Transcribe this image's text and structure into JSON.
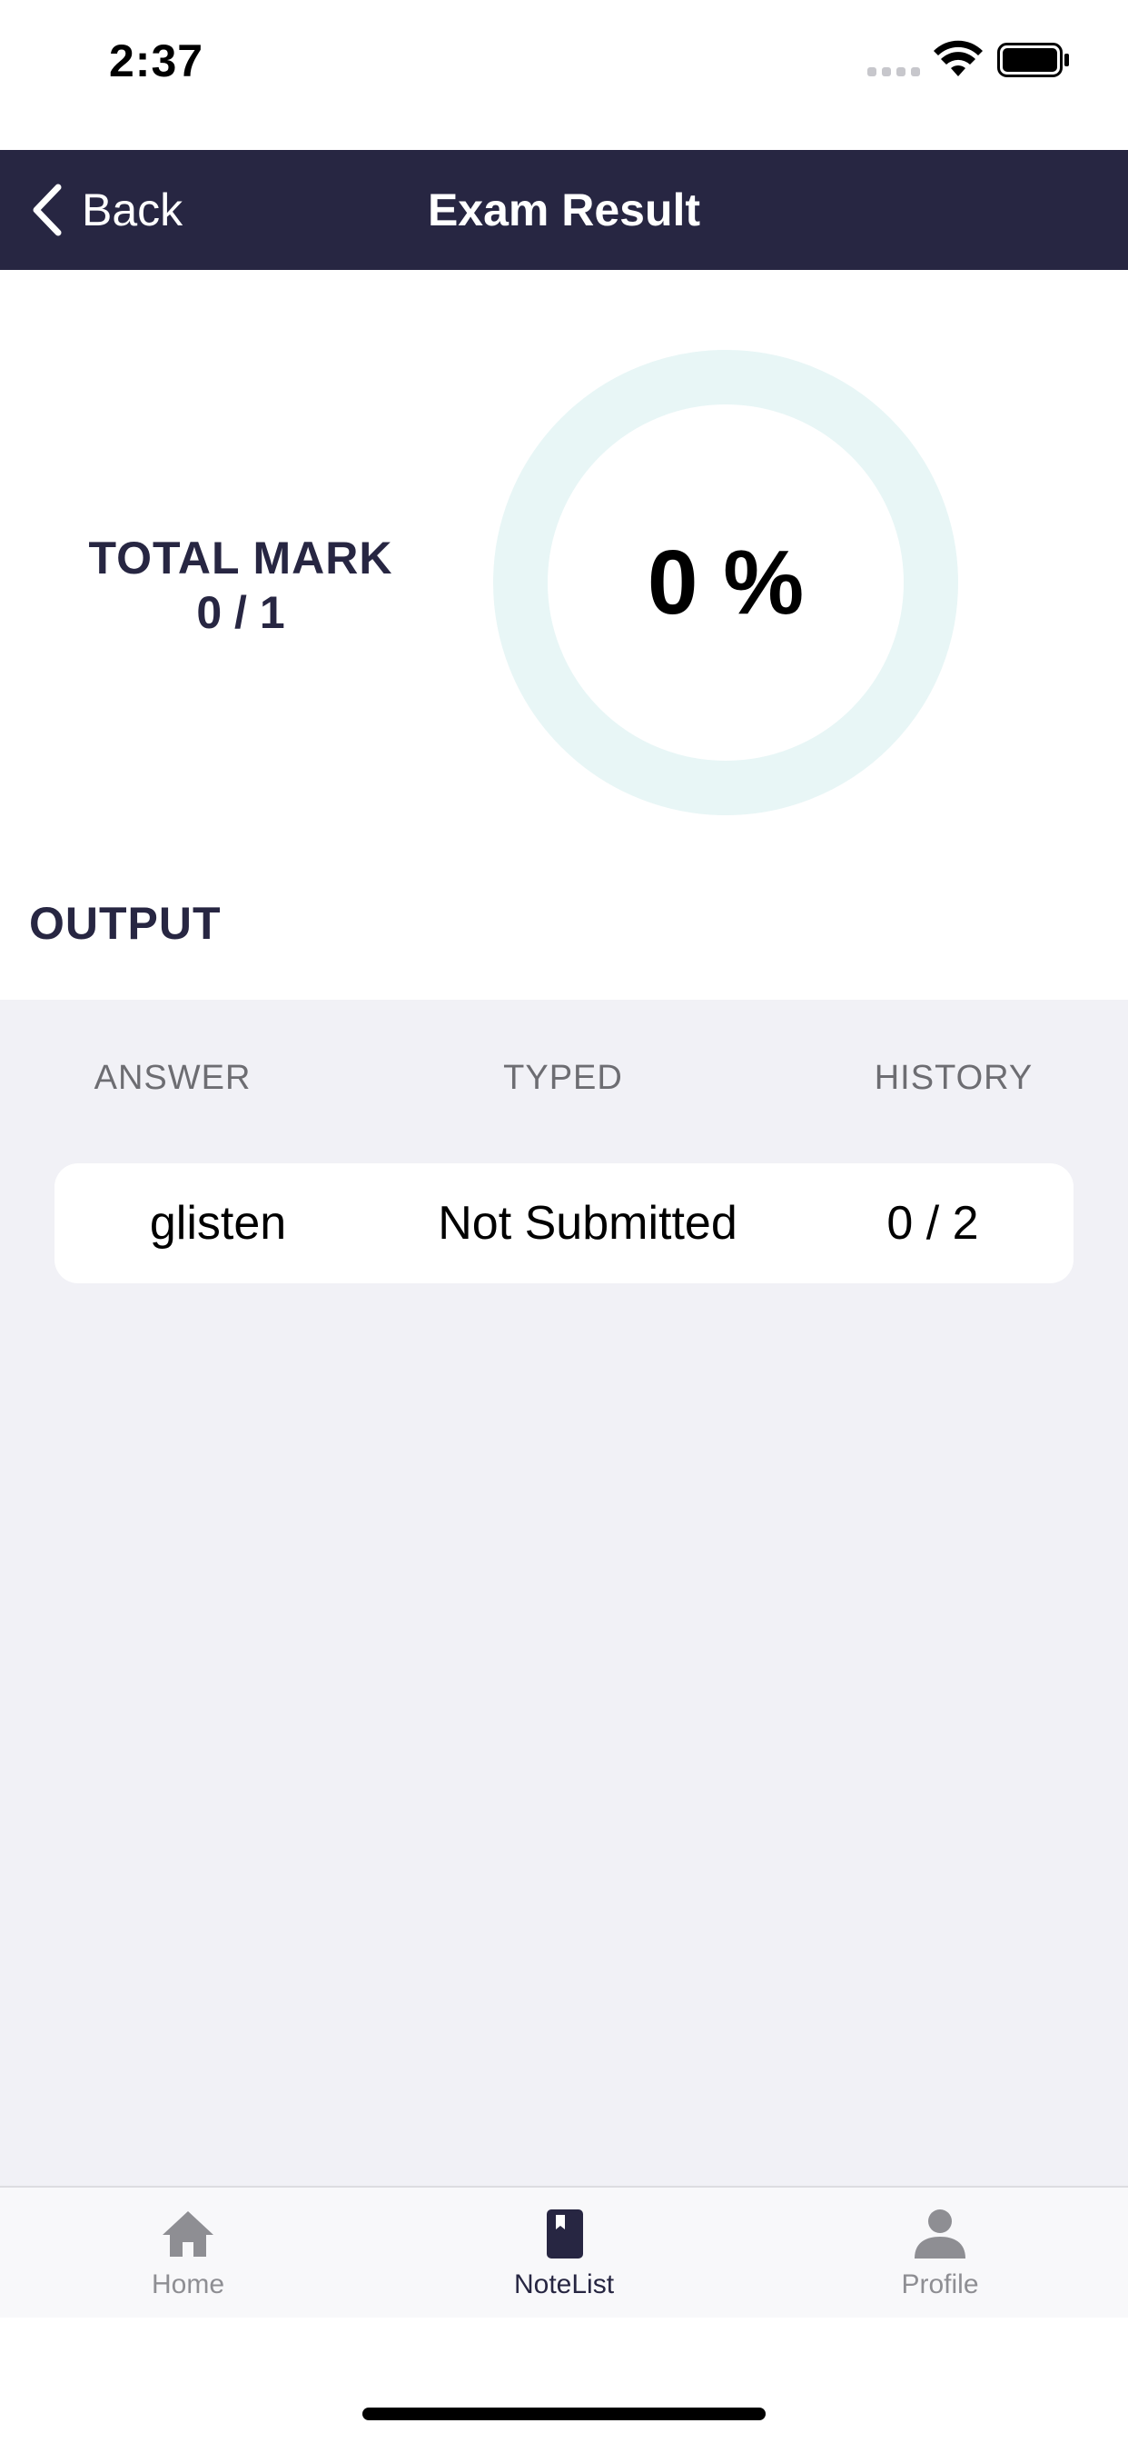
{
  "status_bar": {
    "time": "2:37"
  },
  "nav": {
    "back_label": "Back",
    "title": "Exam Result",
    "background_color": "#272642"
  },
  "summary": {
    "total_mark_label": "TOTAL MARK",
    "total_mark_value": "0 / 1",
    "percent_text": "0 %",
    "percent_value": 0,
    "ring_track_color": "#e8f6f6"
  },
  "output": {
    "section_title": "OUTPUT",
    "columns": [
      "ANSWER",
      "TYPED",
      "HISTORY"
    ],
    "rows": [
      {
        "answer": "glisten",
        "typed": "Not Submitted",
        "history": "0 / 2"
      }
    ]
  },
  "tab_bar": {
    "tabs": [
      {
        "label": "Home",
        "icon": "house-icon",
        "active": false
      },
      {
        "label": "NoteList",
        "icon": "notebook-icon",
        "active": true
      },
      {
        "label": "Profile",
        "icon": "person-icon",
        "active": false
      }
    ],
    "active_color": "#272642",
    "inactive_color": "#8e8e93"
  }
}
